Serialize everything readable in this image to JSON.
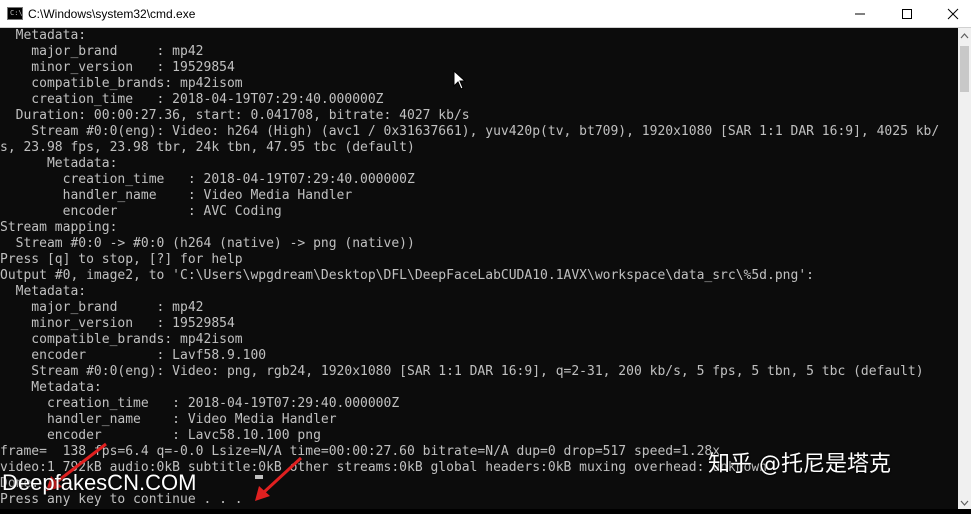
{
  "window": {
    "title": "C:\\Windows\\system32\\cmd.exe",
    "icon_label": "C:\\",
    "buttons": [
      "minimize-icon",
      "maximize-icon",
      "close-icon"
    ]
  },
  "console": {
    "lines": [
      "  Metadata:",
      "    major_brand     : mp42",
      "    minor_version   : 19529854",
      "    compatible_brands: mp42isom",
      "    creation_time   : 2018-04-19T07:29:40.000000Z",
      "  Duration: 00:00:27.36, start: 0.041708, bitrate: 4027 kb/s",
      "    Stream #0:0(eng): Video: h264 (High) (avc1 / 0x31637661), yuv420p(tv, bt709), 1920x1080 [SAR 1:1 DAR 16:9], 4025 kb/",
      "s, 23.98 fps, 23.98 tbr, 24k tbn, 47.95 tbc (default)",
      "      Metadata:",
      "        creation_time   : 2018-04-19T07:29:40.000000Z",
      "        handler_name    : Video Media Handler",
      "        encoder         : AVC Coding",
      "Stream mapping:",
      "  Stream #0:0 -> #0:0 (h264 (native) -> png (native))",
      "Press [q] to stop, [?] for help",
      "Output #0, image2, to 'C:\\Users\\wpgdream\\Desktop\\DFL\\DeepFaceLabCUDA10.1AVX\\workspace\\data_src\\%5d.png':",
      "  Metadata:",
      "    major_brand     : mp42",
      "    minor_version   : 19529854",
      "    compatible_brands: mp42isom",
      "    encoder         : Lavf58.9.100",
      "    Stream #0:0(eng): Video: png, rgb24, 1920x1080 [SAR 1:1 DAR 16:9], q=2-31, 200 kb/s, 5 fps, 5 tbn, 5 tbc (default)",
      "    Metadata:",
      "      creation_time   : 2018-04-19T07:29:40.000000Z",
      "      handler_name    : Video Media Handler",
      "      encoder         : Lavc58.10.100 png",
      "frame=  138 fps=6.4 q=-0.0 Lsize=N/A time=00:00:27.60 bitrate=N/A dup=0 drop=517 speed=1.28x",
      "video:1 792kB audio:0kB subtitle:0kB other streams:0kB global headers:0kB muxing overhead: unknown",
      "Done.",
      "Press any key to continue . . ."
    ]
  },
  "overlay": {
    "watermark_left": "DeepfakesCN.COM",
    "watermark_right": "知乎 @托尼是塔克",
    "arrow_color": "#e02020"
  },
  "colors": {
    "console_bg": "#0c0c0c",
    "console_fg": "#c0c0c0",
    "titlebar_bg": "#ffffff"
  }
}
